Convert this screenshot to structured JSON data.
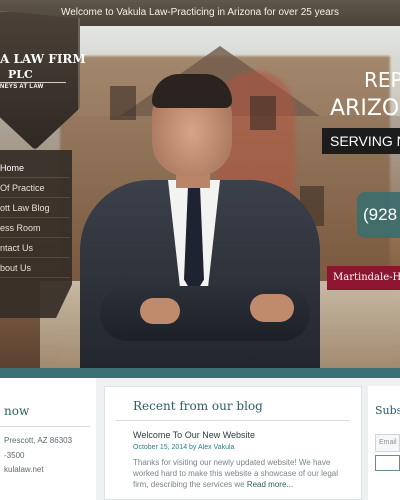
{
  "topbar": {
    "text": "Welcome to Vakula Law-Practicing in Arizona for over 25 years"
  },
  "logo": {
    "line1": "A LAW FIRM",
    "line2": "PLC",
    "line3": "NEYS AT LAW"
  },
  "nav": {
    "items": [
      {
        "label": "Home",
        "active": true
      },
      {
        "label": "Of Practice"
      },
      {
        "label": "ott Law Blog"
      },
      {
        "label": "ess Room"
      },
      {
        "label": "ntact Us"
      },
      {
        "label": "bout Us"
      }
    ]
  },
  "hero": {
    "headline1": "REPF",
    "headline2": "ARIZON",
    "headline3": "SERVING N",
    "phone": "(928",
    "badge": "Martindale-Hu"
  },
  "contact": {
    "title": "now",
    "lines": [
      "Prescott, AZ 86303",
      "-3500",
      "kulalaw.net"
    ]
  },
  "blog": {
    "title": "Recent from our blog",
    "post_title": "Welcome To Our New Website",
    "post_meta": "October 15, 2014 by Alex Vakula",
    "excerpt": "Thanks for visiting our newly updated website! We have worked hard to make this website a showcase of our legal firm, describing the services we",
    "read_more": "Read more..."
  },
  "subscribe": {
    "title": "Subsc",
    "email_placeholder": "Email"
  },
  "colors": {
    "accent": "#3a6f75",
    "badge": "#8e1530",
    "phone_bg": "#3c6e6e"
  }
}
